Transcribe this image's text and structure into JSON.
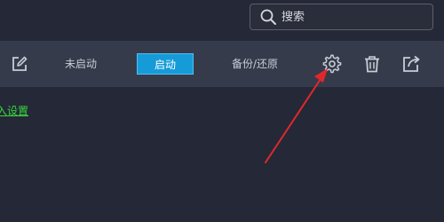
{
  "search": {
    "placeholder": "搜索",
    "icon": "search-icon"
  },
  "toolbar": {
    "edit_icon": "edit-icon",
    "not_started_label": "未启动",
    "start_label": "启动",
    "backup_restore_label": "备份/还原",
    "settings_icon": "gear-icon",
    "delete_icon": "trash-icon",
    "share_icon": "export-icon"
  },
  "content": {
    "settings_link": "入设置"
  },
  "colors": {
    "background": "#252836",
    "toolbar": "#363b4b",
    "accent": "#159bd8",
    "link": "#37d63d",
    "annotation_arrow": "#e0282c"
  }
}
